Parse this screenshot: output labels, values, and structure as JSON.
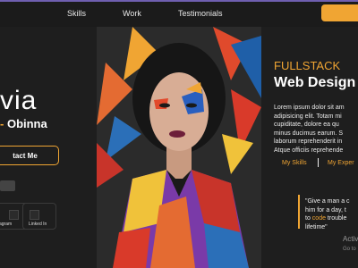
{
  "nav": {
    "items": [
      "Skills",
      "Work",
      "Testimonials"
    ]
  },
  "hero": {
    "name": "via",
    "lastname_prefix": "- ",
    "lastname": "Obinna",
    "contact_label": "tact Me",
    "small_tag": ""
  },
  "cards": [
    {
      "label": "agram"
    },
    {
      "label": "Linked In"
    }
  ],
  "right": {
    "fullstack": "FULLSTACK",
    "web_design": "Web Design",
    "paragraph": [
      "Lorem ipsum dolor sit am",
      "adipisicing elit. Totam mi",
      "cupiditate, dolore ea qu",
      "minus ducimus earum. S",
      "laborum reprehenderit in",
      "Atque officiis reprehende"
    ],
    "tab_skills": "My Skills",
    "tab_experience": "My Exper"
  },
  "quote": {
    "line1": "\"Give a man a c",
    "line2": "him for a day, t",
    "line3_hl": "code",
    "line3_pre": "to ",
    "line3_post": " trouble",
    "line4": "lifetime\""
  },
  "watermark": {
    "line1": "Activ",
    "line2": "Go to"
  },
  "colors": {
    "accent": "#f0a533",
    "background": "#1e1e1e"
  }
}
